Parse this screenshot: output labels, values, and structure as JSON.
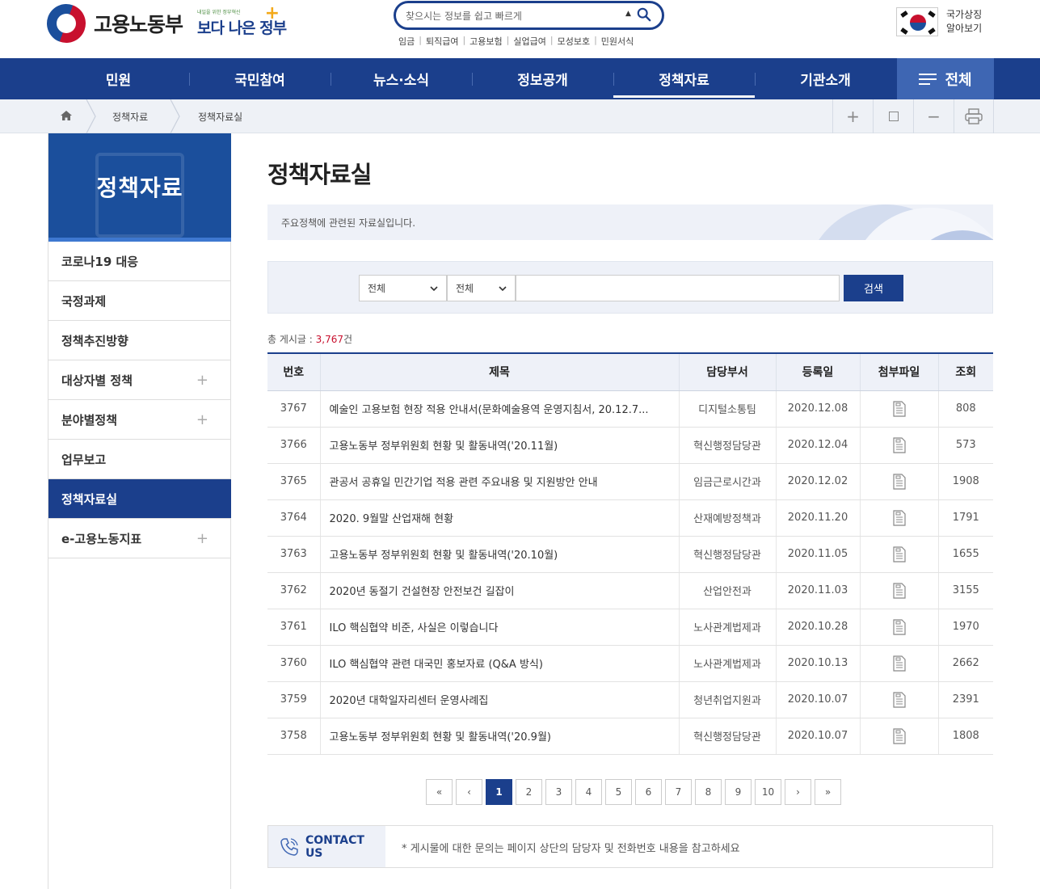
{
  "header": {
    "logo_text": "고용노동부",
    "slogan_small": "내일을 위한 정부혁신",
    "slogan_main": "보다 나은 정부",
    "search_placeholder": "찾으시는 정보를 쉽고 빠르게",
    "quick_links": [
      "임금",
      "퇴직급여",
      "고용보험",
      "실업급여",
      "모성보호",
      "민원서식"
    ],
    "national_symbol": "국가상징 알아보기"
  },
  "gnb": {
    "items": [
      "민원",
      "국민참여",
      "뉴스·소식",
      "정보공개",
      "정책자료",
      "기관소개"
    ],
    "active_index": 4,
    "all_label": "전체"
  },
  "breadcrumb": [
    "정책자료",
    "정책자료실"
  ],
  "tools": [
    "zoom-in",
    "reset",
    "zoom-out",
    "print"
  ],
  "sidebar": {
    "title": "정책자료",
    "items": [
      {
        "label": "코로나19 대응",
        "expandable": false
      },
      {
        "label": "국정과제",
        "expandable": false
      },
      {
        "label": "정책추진방향",
        "expandable": false
      },
      {
        "label": "대상자별 정책",
        "expandable": true
      },
      {
        "label": "분야별정책",
        "expandable": true
      },
      {
        "label": "업무보고",
        "expandable": false
      },
      {
        "label": "정책자료실",
        "expandable": false,
        "active": true
      },
      {
        "label": "e-고용노동지표",
        "expandable": true
      }
    ]
  },
  "main": {
    "title": "정책자료실",
    "description": "주요정책에 관련된 자료실입니다.",
    "filter": {
      "select1": "전체",
      "select2": "전체",
      "button": "검색"
    },
    "total_label": "총 게시글 : ",
    "total_count": "3,767",
    "total_unit": "건"
  },
  "table": {
    "headers": [
      "번호",
      "제목",
      "담당부서",
      "등록일",
      "첨부파일",
      "조회"
    ],
    "rows": [
      {
        "no": "3767",
        "title": "예술인 고용보험 현장 적용 안내서(문화예술용역 운영지침서, 20.12.7...",
        "dept": "디지털소통팀",
        "date": "2020.12.08",
        "views": "808"
      },
      {
        "no": "3766",
        "title": "고용노동부 정부위원회 현황 및 활동내역('20.11월)",
        "dept": "혁신행정담당관",
        "date": "2020.12.04",
        "views": "573"
      },
      {
        "no": "3765",
        "title": "관공서 공휴일 민간기업 적용 관련 주요내용 및 지원방안 안내",
        "dept": "임금근로시간과",
        "date": "2020.12.02",
        "views": "1908"
      },
      {
        "no": "3764",
        "title": "2020. 9월말 산업재해 현황",
        "dept": "산재예방정책과",
        "date": "2020.11.20",
        "views": "1791"
      },
      {
        "no": "3763",
        "title": "고용노동부 정부위원회 현황 및 활동내역('20.10월)",
        "dept": "혁신행정담당관",
        "date": "2020.11.05",
        "views": "1655"
      },
      {
        "no": "3762",
        "title": "2020년 동절기 건설현장 안전보건 길잡이",
        "dept": "산업안전과",
        "date": "2020.11.03",
        "views": "3155"
      },
      {
        "no": "3761",
        "title": "ILO 핵심협약 비준, 사실은 이렇습니다",
        "dept": "노사관계법제과",
        "date": "2020.10.28",
        "views": "1970"
      },
      {
        "no": "3760",
        "title": "ILO 핵심협약 관련 대국민 홍보자료 (Q&A 방식)",
        "dept": "노사관계법제과",
        "date": "2020.10.13",
        "views": "2662"
      },
      {
        "no": "3759",
        "title": "2020년 대학일자리센터 운영사례집",
        "dept": "청년취업지원과",
        "date": "2020.10.07",
        "views": "2391"
      },
      {
        "no": "3758",
        "title": "고용노동부 정부위원회 현황 및 활동내역('20.9월)",
        "dept": "혁신행정담당관",
        "date": "2020.10.07",
        "views": "1808"
      }
    ]
  },
  "pagination": {
    "first": "«",
    "prev": "‹",
    "pages": [
      "1",
      "2",
      "3",
      "4",
      "5",
      "6",
      "7",
      "8",
      "9",
      "10"
    ],
    "current": "1",
    "next": "›",
    "last": "»"
  },
  "contact": {
    "label": "CONTACT US",
    "text": "* 게시물에 대한 문의는 페이지 상단의 담당자 및 전화번호 내용을 참고하세요"
  },
  "colors": {
    "primary": "#1b3f8c",
    "accent": "#c8102e",
    "light_bg": "#eef1f8"
  }
}
